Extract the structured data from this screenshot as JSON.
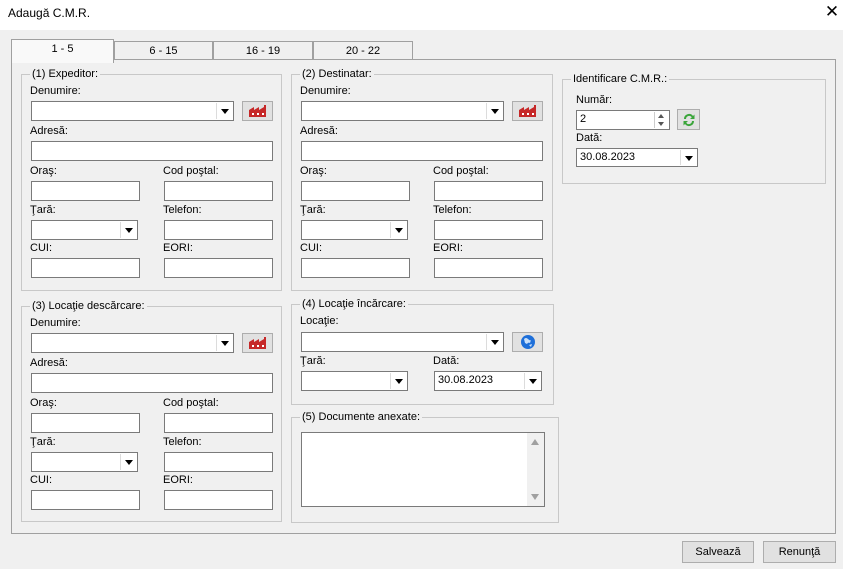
{
  "window": {
    "title": "Adaugă C.M.R.",
    "close_glyph": "✕"
  },
  "tabs": [
    {
      "label": "1 - 5",
      "active": true
    },
    {
      "label": "6 - 15"
    },
    {
      "label": "16 - 19"
    },
    {
      "label": "20 - 22"
    }
  ],
  "expeditor": {
    "legend": "(1) Expeditor:",
    "denumire_label": "Denumire:",
    "denumire_value": "",
    "adresa_label": "Adresă:",
    "adresa_value": "",
    "oras_label": "Oraş:",
    "oras_value": "",
    "cod_postal_label": "Cod poştal:",
    "cod_postal_value": "",
    "tara_label": "Ţară:",
    "tara_value": "",
    "telefon_label": "Telefon:",
    "telefon_value": "",
    "cui_label": "CUI:",
    "cui_value": "",
    "eori_label": "EORI:",
    "eori_value": ""
  },
  "destinatar": {
    "legend": "(2) Destinatar:",
    "denumire_label": "Denumire:",
    "denumire_value": "",
    "adresa_label": "Adresă:",
    "adresa_value": "",
    "oras_label": "Oraş:",
    "oras_value": "",
    "cod_postal_label": "Cod poştal:",
    "cod_postal_value": "",
    "tara_label": "Ţară:",
    "tara_value": "",
    "telefon_label": "Telefon:",
    "telefon_value": "",
    "cui_label": "CUI:",
    "cui_value": "",
    "eori_label": "EORI:",
    "eori_value": ""
  },
  "descarcare": {
    "legend": "(3) Locaţie descărcare:",
    "denumire_label": "Denumire:",
    "denumire_value": "",
    "adresa_label": "Adresă:",
    "adresa_value": "",
    "oras_label": "Oraş:",
    "oras_value": "",
    "cod_postal_label": "Cod poştal:",
    "cod_postal_value": "",
    "tara_label": "Ţară:",
    "tara_value": "",
    "telefon_label": "Telefon:",
    "telefon_value": "",
    "cui_label": "CUI:",
    "cui_value": "",
    "eori_label": "EORI:",
    "eori_value": ""
  },
  "incarcare": {
    "legend": "(4) Locaţie încărcare:",
    "locatie_label": "Locaţie:",
    "locatie_value": "",
    "tara_label": "Ţară:",
    "tara_value": "",
    "data_label": "Dată:",
    "data_value": "30.08.2023"
  },
  "documente": {
    "legend": "(5) Documente anexate:",
    "value": ""
  },
  "identificare": {
    "legend": "Identificare C.M.R.:",
    "numar_label": "Număr:",
    "numar_value": "2",
    "data_label": "Dată:",
    "data_value": "30.08.2023"
  },
  "buttons": {
    "save": "Salvează",
    "cancel": "Renunţă"
  },
  "icons": {
    "company": "factory-icon",
    "location": "globe-icon",
    "refresh": "refresh-icon"
  },
  "colors": {
    "factory": "#c62828",
    "globe": "#1e6fd9",
    "refresh": "#3aa53a"
  }
}
